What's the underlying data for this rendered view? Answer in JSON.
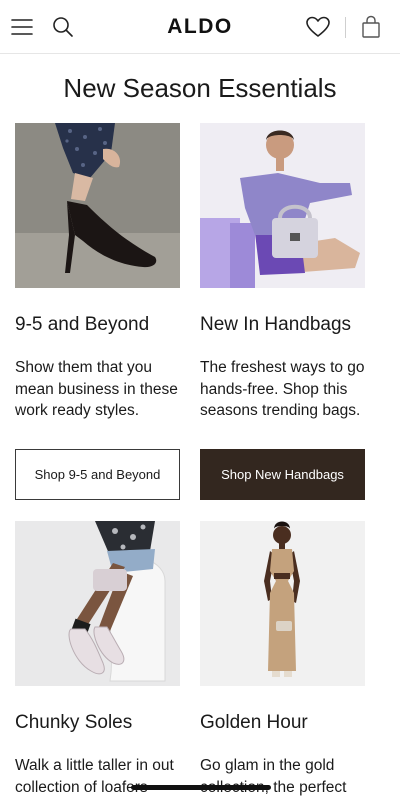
{
  "header": {
    "logo": "ALDO",
    "icons": [
      "menu-icon",
      "search-icon",
      "heart-icon",
      "shopping-bag-icon"
    ]
  },
  "section": {
    "title": "New Season Essentials"
  },
  "cards": [
    {
      "title": "9-5 and Beyond",
      "description": "Show them that you mean business in these work ready styles.",
      "button_label": "Shop 9-5 and Beyond",
      "button_style": "outline"
    },
    {
      "title": "New In Handbags",
      "description": "The freshest ways to go hands-free. Shop this seasons trending bags.",
      "button_label": "Shop New Handbags",
      "button_style": "dark"
    },
    {
      "title": "Chunky Soles",
      "description": "Walk a little taller in out collection of loafers"
    },
    {
      "title": "Golden Hour",
      "description": "Go glam in the gold collection, the perfect"
    }
  ],
  "colors": {
    "text": "#1a1a1a",
    "dark_button": "#33271f",
    "divider": "#e6e6e6"
  }
}
